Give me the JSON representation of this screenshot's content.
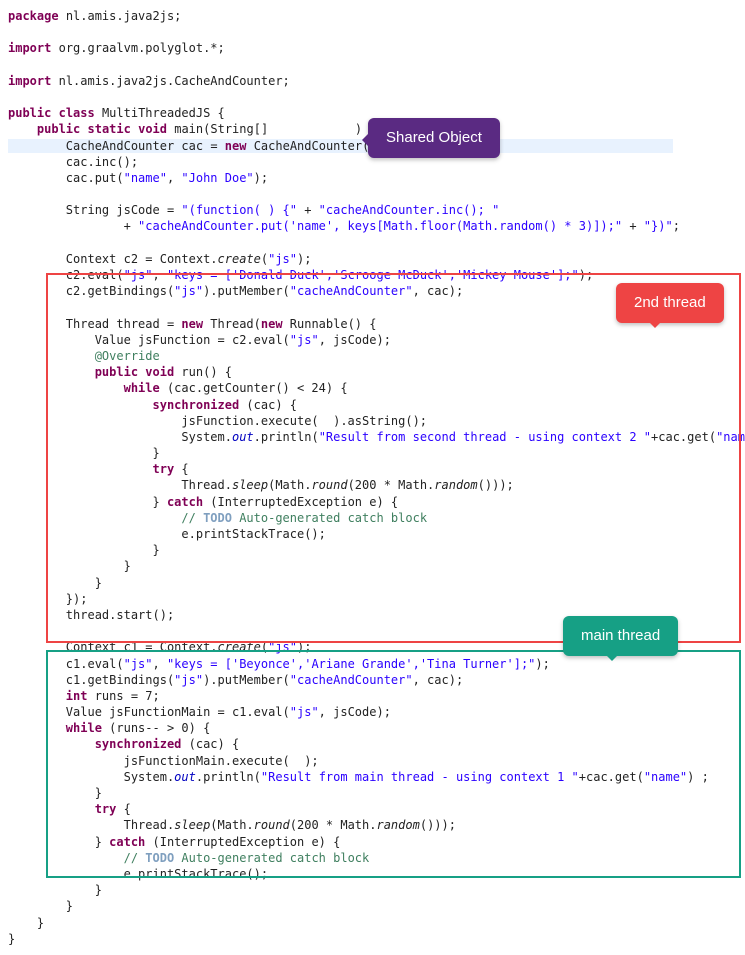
{
  "code": {
    "package_kw": "package",
    "package_name": "nl.amis.java2js;",
    "import_kw": "import",
    "import1": "org.graalvm.polyglot.*;",
    "import2": "nl.amis.java2js.CacheAndCounter;",
    "class_decl": {
      "public": "public",
      "class": "class",
      "name": "MultiThreadedJS {"
    },
    "main_sig": {
      "public": "public",
      "static": "static",
      "void": "void",
      "name": "main",
      "params": "(String[]            )  {"
    },
    "l_cac_decl": {
      "type": "CacheAndCounter",
      "var": "cac",
      "eq": " = ",
      "new": "new",
      "ctor": " CacheAndCounter();"
    },
    "l_cac_inc": "cac.inc();",
    "l_cac_put": {
      "pre": "cac.put(",
      "s1": "\"name\"",
      "mid": ", ",
      "s2": "\"John Doe\"",
      "post": ");"
    },
    "l_jscode1": {
      "pre": "String jsCode = ",
      "s1": "\"(function( ) {\"",
      "p1": " + ",
      "s2": "\"cacheAndCounter.inc(); \""
    },
    "l_jscode2": {
      "p0": "           + ",
      "s1": "\"cacheAndCounter.put('name', keys[Math.floor(Math.random() * 3)]);\"",
      "p1": " + ",
      "s2": "\"})\"",
      "post": ";"
    },
    "l_c2_create": {
      "pre": "Context c2 = Context.",
      "m": "create",
      "post": "(",
      "s": "\"js\"",
      "end": ");"
    },
    "l_c2_eval": {
      "pre": "c2.eval(",
      "s1": "\"js\"",
      "mid": ", ",
      "s2": "\"keys = ['Donald Duck','Scrooge McDuck','Mickey Mouse'];\"",
      "post": ");"
    },
    "l_c2_bind": {
      "pre": "c2.getBindings(",
      "s1": "\"js\"",
      "mid": ").putMember(",
      "s2": "\"cacheAndCounter\"",
      "post": ", cac);"
    },
    "l_thread_decl": {
      "pre": "Thread thread = ",
      "new1": "new",
      "mid": " Thread(",
      "new2": "new",
      "post": " Runnable() {"
    },
    "l_value_jsfun": {
      "pre": "Value jsFunction = c2.eval(",
      "s1": "\"js\"",
      "mid": ", jsCode);"
    },
    "l_override": "@Override",
    "l_run_sig": {
      "public": "public",
      "void": "void",
      "rest": " run() {"
    },
    "l_while_t2": {
      "kw": "while",
      "rest": " (cac.getCounter() < 24) {"
    },
    "l_sync_t2": {
      "kw": "synchronized",
      "rest": " (cac) {"
    },
    "l_jsfun_exec": "jsFunction.execute(  ).asString();",
    "l_sysout_t2": {
      "pre": "System.",
      "out": "out",
      "mid": ".println(",
      "s": "\"Result from second thread - using context 2 \"",
      "post": "+cac.get(",
      "s2": "\"name\"",
      "end": "));"
    },
    "l_brace_close": "}",
    "l_try": {
      "kw": "try",
      "rest": " {"
    },
    "l_sleep": {
      "pre": "Thread.",
      "m": "sleep",
      "mid": "(Math.",
      "m2": "round",
      "post": "(200 * Math.",
      "m3": "random",
      "end": "()));"
    },
    "l_catch": {
      "p0": "} ",
      "kw": "catch",
      "rest": " (InterruptedException e) {"
    },
    "l_todo": {
      "slashes": "// ",
      "todo": "TODO",
      "rest": " Auto-generated catch block"
    },
    "l_printstack": "e.printStackTrace();",
    "l_thread_close": "});",
    "l_thread_start": "thread.start();",
    "l_c1_create": {
      "pre": "Context c1 = Context.",
      "m": "create",
      "post": "(",
      "s": "\"js\"",
      "end": ");"
    },
    "l_c1_eval": {
      "pre": "c1.eval(",
      "s1": "\"js\"",
      "mid": ", ",
      "s2": "\"keys = ['Beyonce','Ariane Grande','Tina Turner'];\"",
      "post": ");"
    },
    "l_c1_bind": {
      "pre": "c1.getBindings(",
      "s1": "\"js\"",
      "mid": ").putMember(",
      "s2": "\"cacheAndCounter\"",
      "post": ", cac);"
    },
    "l_int_runs": {
      "kw": "int",
      "rest": " runs = 7;"
    },
    "l_jsfunmain": {
      "pre": "Value jsFunctionMain = c1.eval(",
      "s1": "\"js\"",
      "post": ", jsCode);"
    },
    "l_while_main": {
      "kw": "while",
      "rest": " (runs-- > 0) {"
    },
    "l_sync_main": {
      "kw": "synchronized",
      "rest": " (cac) {"
    },
    "l_jsfunmain_exec": "jsFunctionMain.execute(  );",
    "l_sysout_main": {
      "pre": "System.",
      "out": "out",
      "mid": ".println(",
      "s": "\"Result from main thread - using context 1 \"",
      "post": "+cac.get(",
      "s2": "\"name\"",
      "end": ") ;"
    }
  },
  "callouts": {
    "shared_object": "Shared Object",
    "second_thread": "2nd thread",
    "main_thread": "main thread"
  }
}
